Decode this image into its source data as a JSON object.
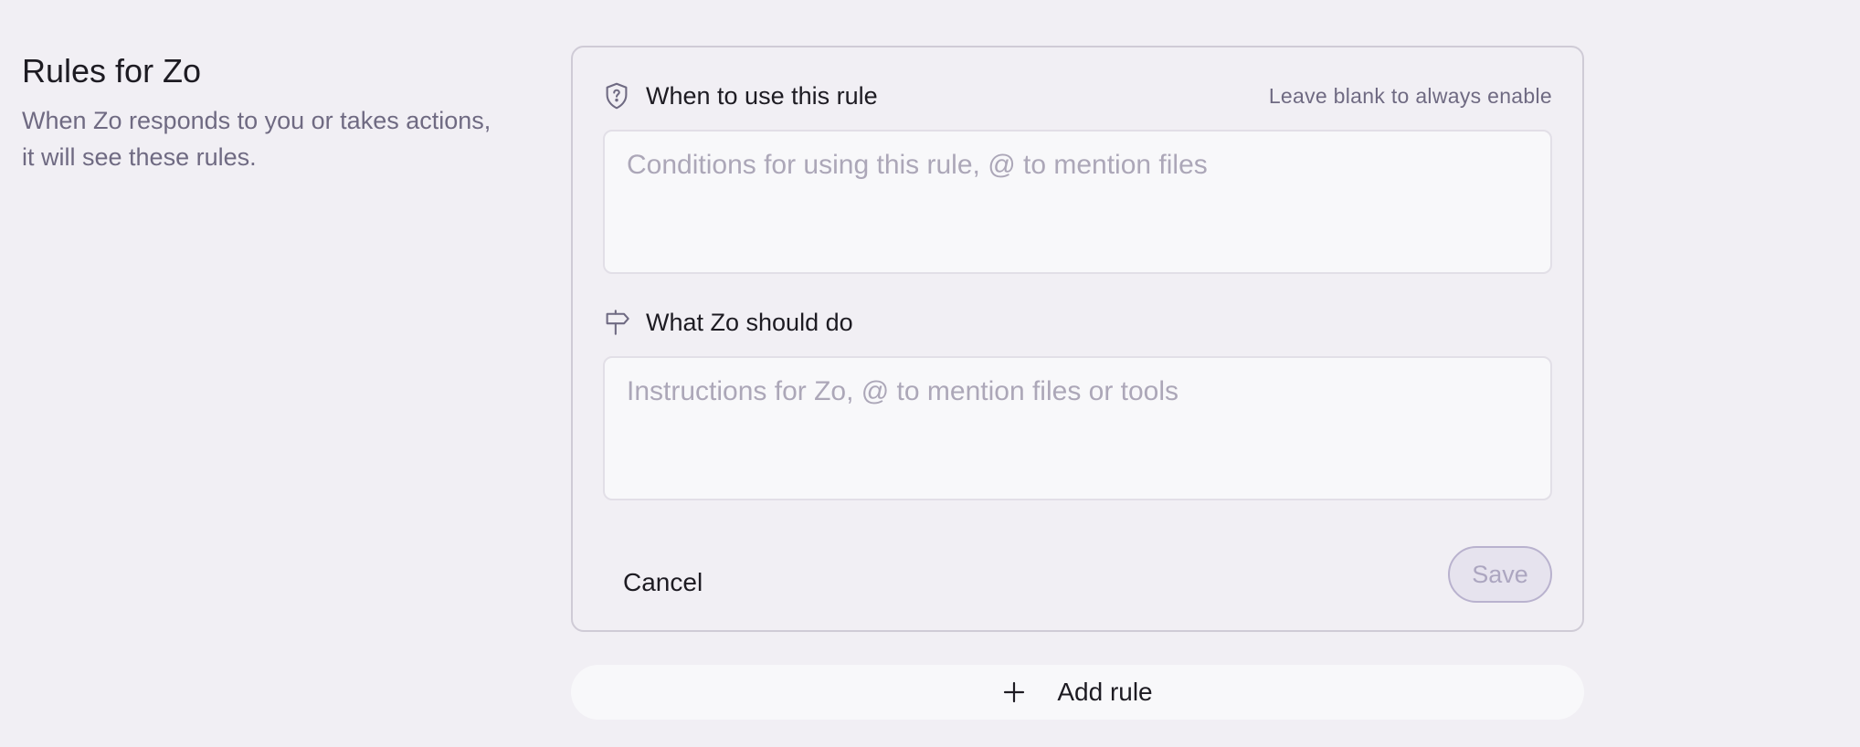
{
  "intro": {
    "title": "Rules for Zo",
    "description": "When Zo responds to you or takes actions, it will see these rules."
  },
  "rule_form": {
    "condition": {
      "icon": "shield-question-icon",
      "label": "When to use this rule",
      "hint": "Leave blank to always enable",
      "placeholder": "Conditions for using this rule, @ to mention files",
      "value": ""
    },
    "instructions": {
      "icon": "signpost-icon",
      "label": "What Zo should do",
      "placeholder": "Instructions for Zo, @ to mention files or tools",
      "value": ""
    },
    "cancel_label": "Cancel",
    "save_label": "Save"
  },
  "add_rule": {
    "icon": "plus-icon",
    "label": "Add rule"
  },
  "colors": {
    "background": "#f1eff4",
    "muted_text": "#6f6a82",
    "placeholder": "#aca7b8",
    "save_disabled_bg": "#e6e3ee",
    "save_disabled_text": "#aca6c0"
  }
}
